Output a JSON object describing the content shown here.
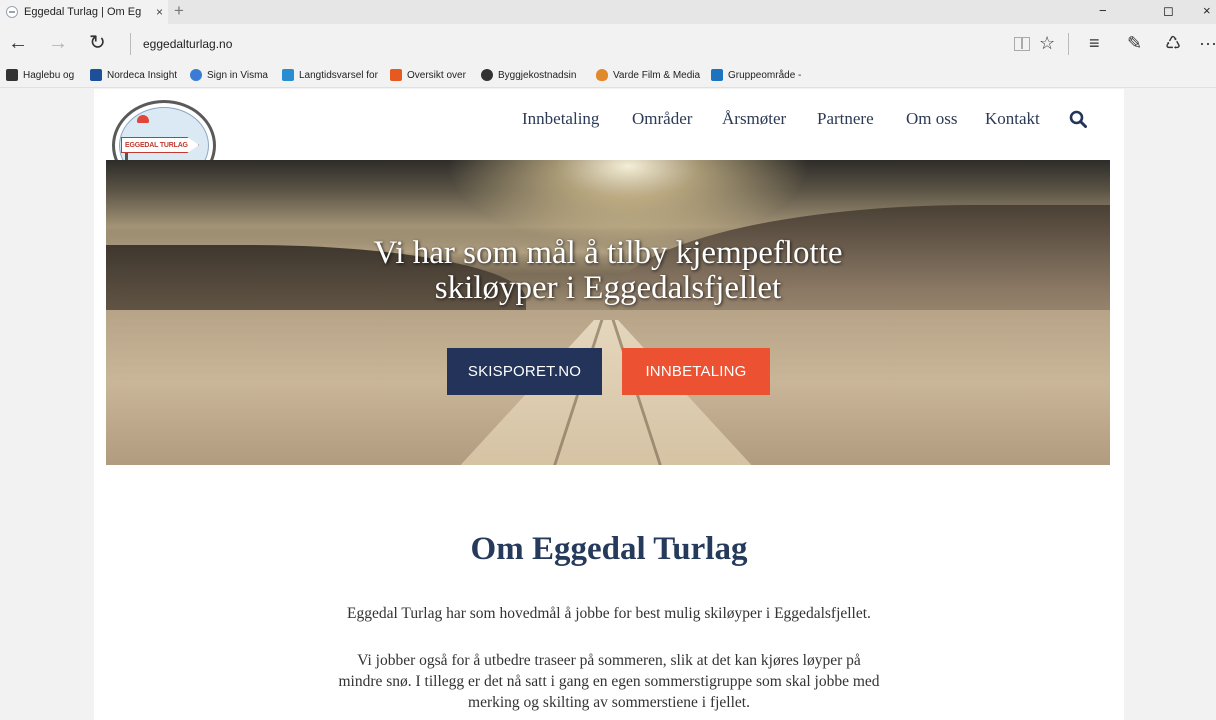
{
  "browser": {
    "tab": {
      "title": "Eggedal Turlag | Om Eg",
      "close": "×"
    },
    "new_tab": "+",
    "window_controls": {
      "minimize": "−",
      "maximize": "◻",
      "close": "×"
    },
    "nav": {
      "back": "←",
      "forward": "→",
      "refresh": "↻"
    },
    "url": "eggedalturlag.no",
    "tools": {
      "favorite": "☆",
      "hub": "≡",
      "notes": "✎",
      "share": "♺",
      "more": "···"
    },
    "favorites": [
      {
        "label": "Haglebu og",
        "icon": "haglebu-icon",
        "color": "#333333"
      },
      {
        "label": "Nordeca Insight",
        "icon": "nordeca-icon",
        "color": "#1d4f9a"
      },
      {
        "label": "Sign in  Visma",
        "icon": "visma-icon",
        "color": "#3a7bd5"
      },
      {
        "label": "Langtidsvarsel for",
        "icon": "yr-icon",
        "color": "#2a8cd1"
      },
      {
        "label": "Oversikt over",
        "icon": "oversikt-icon",
        "color": "#e65a1f"
      },
      {
        "label": "Byggjekostnadsin",
        "icon": "bygg-icon",
        "color": "#333333"
      },
      {
        "label": "Varde Film & Media",
        "icon": "varde-icon",
        "color": "#e08a2b"
      },
      {
        "label": "Gruppeområde -",
        "icon": "sharepoint-icon",
        "color": "#1e73be"
      }
    ]
  },
  "site": {
    "logo_text": "EGGEDAL TURLAG",
    "nav": [
      "Innbetaling",
      "Områder",
      "Årsmøter",
      "Partnere",
      "Om oss",
      "Kontakt"
    ],
    "hero": {
      "title_line1": "Vi har som mål å tilby kjempeflotte",
      "title_line2": "skiløyper i Eggedalsfjellet",
      "button_primary": "SKISPORET.NO",
      "button_secondary": "INNBETALING"
    },
    "about": {
      "title": "Om Eggedal Turlag",
      "p1": "Eggedal Turlag har som hovedmål å jobbe for best mulig skiløyper i Eggedalsfjellet.",
      "p2_line1": "Vi jobber også for å utbedre traseer på sommeren, slik at det kan kjøres løyper på",
      "p2_line2": "mindre snø. I tillegg er det nå satt i gang en egen sommerstigruppe som skal jobbe med",
      "p2_line3": "merking og skilting av sommerstiene i fjellet."
    }
  },
  "colors": {
    "navy": "#233359",
    "orange": "#ec5132",
    "title": "#263a5c"
  }
}
